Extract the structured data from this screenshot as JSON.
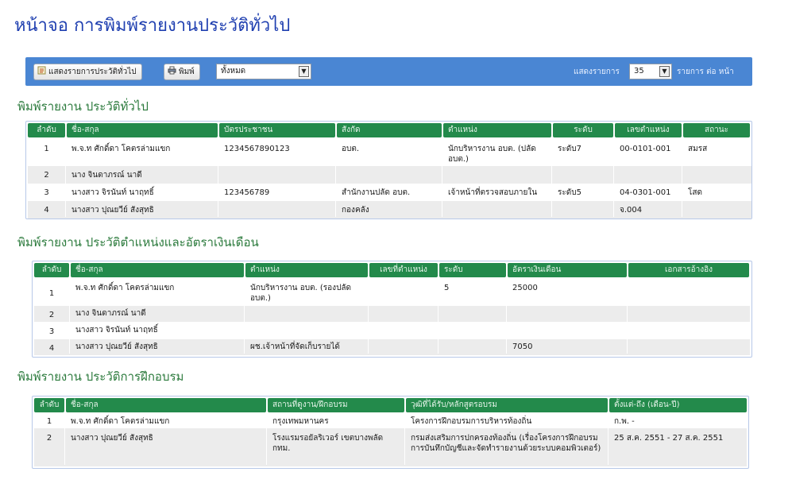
{
  "page": {
    "title": "หน้าจอ การพิมพ์รายงานประวัติทั่วไป"
  },
  "toolbar": {
    "show_button": "แสดงรายการประวัติทั่วไป",
    "print_button": "พิมพ์",
    "filter_value": "ทั้งหมด",
    "show_label": "แสดงรายการ",
    "per_page_value": "35",
    "per_page_suffix": "รายการ ต่อ หน้า"
  },
  "section1": {
    "title": "พิมพ์รายงาน ประวัติทั่วไป",
    "headers": [
      "ลำดับ",
      "ชื่อ-สกุล",
      "บัตรประชาชน",
      "สังกัด",
      "ตำแหน่ง",
      "ระดับ",
      "เลขตำแหน่ง",
      "สถานะ"
    ],
    "rows": [
      [
        "1",
        "พ.จ.ท ศักดิ์ดา โคตรล่ามแขก",
        "1234567890123",
        "อบต.",
        "นักบริหารงาน อบต. (ปลัด อบต.)",
        "ระดับ7",
        "00-0101-001",
        "สมรส"
      ],
      [
        "2",
        "นาง จินดาภรณ์ นาดี",
        "",
        "",
        "",
        "",
        "",
        ""
      ],
      [
        "3",
        "นางสาว จิรนันท์ นาฤทธิ์",
        "123456789",
        "สำนักงานปลัด อบต.",
        "เจ้าหน้าที่ตรวจสอบภายใน",
        "ระดับ5",
        "04-0301-001",
        "โสด"
      ],
      [
        "4",
        "นางสาว ปุณยวีย์ สังสุทธิ",
        "",
        "กองคลัง",
        "",
        "",
        "จ.004",
        ""
      ]
    ]
  },
  "section2": {
    "title": "พิมพ์รายงาน ประวัติตำแหน่งและอัตราเงินเดือน",
    "headers": [
      "ลำดับ",
      "ชื่อ-สกุล",
      "ตำแหน่ง",
      "เลขที่ตำแหน่ง",
      "ระดับ",
      "อัตราเงินเดือน",
      "เอกสารอ้างอิง"
    ],
    "rows": [
      [
        "1",
        "พ.จ.ท ศักดิ์ดา โคตรล่ามแขก",
        "นักบริหารงาน อบต. (รองปลัด อบต.)",
        "",
        "5",
        "25000",
        ""
      ],
      [
        "2",
        "นาง จินดาภรณ์ นาดี",
        "",
        "",
        "",
        "",
        ""
      ],
      [
        "3",
        "นางสาว จิรนันท์ นาฤทธิ์",
        "",
        "",
        "",
        "",
        ""
      ],
      [
        "4",
        "นางสาว ปุณยวีย์ สังสุทธิ",
        "ผช.เจ้าหน้าที่จัดเก็บรายได้",
        "",
        "",
        "7050",
        ""
      ]
    ]
  },
  "section3": {
    "title": "พิมพ์รายงาน ประวัติการฝึกอบรม",
    "headers": [
      "ลำดับ",
      "ชื่อ-สกุล",
      "สถานที่ดูงาน/ฝึกอบรม",
      "วุฒิที่ได้รับ/หลักสูตรอบรม",
      "ตั้งแต่-ถึง (เดือน-ปี)"
    ],
    "rows": [
      [
        "1",
        "พ.จ.ท ศักดิ์ดา โคตรล่ามแขก",
        "กรุงเทพมหานคร",
        "โครงการฝึกอบรมการบริหารท้องถิ่น",
        "ก.พ. -"
      ],
      [
        "2",
        "นางสาว ปุณยวีย์ สังสุทธิ",
        "โรงแรมรอยัลริเวอร์ เขตบางพลัด กทม.",
        "กรมส่งเสริมการปกครองท้องถิ่น (เรื่องโครงการฝึกอบรมการบันทึกบัญชีและจัดทำรายงานด้วยระบบคอมพิวเตอร์)",
        "25 ส.ค. 2551 - 27 ส.ค. 2551"
      ]
    ]
  },
  "icons": {
    "show": "list-icon",
    "print": "printer-icon",
    "dropdown": "chevron-down-icon"
  },
  "colors": {
    "toolbar": "#4a86d3",
    "header": "#238a4b",
    "title": "#1f3fb0",
    "section_title": "#2b7a3c"
  }
}
